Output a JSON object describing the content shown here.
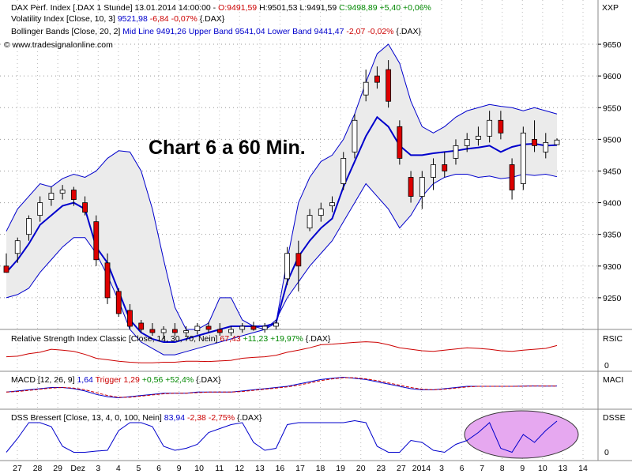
{
  "header": {
    "line1": {
      "prefix": "DAX Perf. Index [.DAX  1 Stunde] 13.01.2014 14:00:00 - ",
      "open": "O:9491,59",
      "high": "H:9501,53",
      "low": "L:9491,59",
      "close": "C:9498,89",
      "change": "+5,40 +0,06%"
    },
    "line2": {
      "prefix": "Volatility Index [Close, 10, 3] ",
      "value": "9521,98",
      "change": "-6,84 -0,07%",
      "suffix": " {.DAX}"
    },
    "line3": {
      "prefix": "Bollinger Bands [Close, 20, 2] ",
      "values": "Mid Line 9491,26 Upper Band 9541,04 Lower Band 9441,47",
      "change": "-2,07 -0,02%",
      "suffix": " {.DAX}"
    },
    "line4": "© www.tradesignalonline.com"
  },
  "overlay_title": "Chart 6 a 60 Min.",
  "panels": {
    "rsi": {
      "prefix": "Relative Strength Index Classic [Close, 14, 30, 70, Nein] ",
      "value": "67,43",
      "change": "+11,23 +19,97%",
      "suffix": " {.DAX}",
      "axis_label": "RSIC",
      "zero_label": "0"
    },
    "macd": {
      "prefix": "MACD [12, 26, 9] ",
      "value": "1,64",
      "trigger": "Trigger",
      "trigger_value": "1,29",
      "change": "+0,56 +52,4%",
      "suffix": " {.DAX}",
      "axis_label": "MACI"
    },
    "dss": {
      "prefix": "DSS Bressert [Close, 13, 4, 0, 100, Nein] ",
      "value": "83,94",
      "change": "-2,38 -2,75%",
      "suffix": " {.DAX}",
      "axis_label": "DSSE",
      "zero_label": "0"
    }
  },
  "colors": {
    "candle_red": "#dd0000",
    "band": "#0000cc",
    "band_fill": "#ebebeb",
    "rsi_line": "#cc0000",
    "highlight": "#e6a8f0"
  },
  "chart_data": {
    "type": "candlestick",
    "y_axis_label": "XXP",
    "ylim": [
      9200,
      9670
    ],
    "y_ticks": [
      9250,
      9300,
      9350,
      9400,
      9450,
      9500,
      9550,
      9600,
      9650
    ],
    "x_tick_labels": [
      "27",
      "28",
      "29",
      "Dez",
      "3",
      "4",
      "5",
      "6",
      "9",
      "10",
      "11",
      "12",
      "13",
      "16",
      "17",
      "18",
      "19",
      "20",
      "23",
      "27",
      "2014",
      "3",
      "6",
      "7",
      "8",
      "9",
      "10",
      "13",
      "14"
    ],
    "bollinger_upper": [
      9355,
      9390,
      9410,
      9430,
      9425,
      9438,
      9445,
      9440,
      9450,
      9470,
      9482,
      9480,
      9450,
      9390,
      9310,
      9235,
      9200,
      9200,
      9210,
      9250,
      9250,
      9215,
      9205,
      9200,
      9210,
      9310,
      9400,
      9440,
      9465,
      9475,
      9500,
      9540,
      9590,
      9635,
      9650,
      9620,
      9560,
      9520,
      9510,
      9520,
      9535,
      9545,
      9550,
      9555,
      9552,
      9550,
      9545,
      9550,
      9545,
      9540
    ],
    "bollinger_lower": [
      9250,
      9255,
      9265,
      9290,
      9310,
      9330,
      9345,
      9345,
      9320,
      9285,
      9245,
      9200,
      9180,
      9170,
      9160,
      9160,
      9165,
      9170,
      9175,
      9180,
      9185,
      9190,
      9195,
      9200,
      9215,
      9250,
      9275,
      9300,
      9320,
      9340,
      9370,
      9400,
      9430,
      9410,
      9390,
      9360,
      9380,
      9410,
      9430,
      9440,
      9445,
      9445,
      9440,
      9442,
      9438,
      9440,
      9445,
      9443,
      9445,
      9441
    ],
    "bollinger_mid": [
      9290,
      9310,
      9335,
      9365,
      9380,
      9395,
      9400,
      9390,
      9330,
      9305,
      9260,
      9215,
      9195,
      9185,
      9180,
      9180,
      9185,
      9190,
      9195,
      9200,
      9205,
      9205,
      9205,
      9205,
      9210,
      9275,
      9315,
      9340,
      9360,
      9375,
      9425,
      9465,
      9505,
      9535,
      9520,
      9490,
      9475,
      9475,
      9478,
      9480,
      9482,
      9485,
      9487,
      9490,
      9480,
      9488,
      9492,
      9493,
      9490,
      9491
    ],
    "candles": [
      {
        "o": 9300,
        "h": 9320,
        "l": 9290,
        "c": 9290
      },
      {
        "o": 9320,
        "h": 9345,
        "l": 9305,
        "c": 9340
      },
      {
        "o": 9350,
        "h": 9380,
        "l": 9340,
        "c": 9375
      },
      {
        "o": 9380,
        "h": 9410,
        "l": 9370,
        "c": 9400
      },
      {
        "o": 9405,
        "h": 9425,
        "l": 9395,
        "c": 9415
      },
      {
        "o": 9415,
        "h": 9428,
        "l": 9405,
        "c": 9420
      },
      {
        "o": 9420,
        "h": 9425,
        "l": 9395,
        "c": 9405
      },
      {
        "o": 9400,
        "h": 9410,
        "l": 9380,
        "c": 9385
      },
      {
        "o": 9370,
        "h": 9380,
        "l": 9300,
        "c": 9310
      },
      {
        "o": 9305,
        "h": 9320,
        "l": 9240,
        "c": 9250
      },
      {
        "o": 9260,
        "h": 9265,
        "l": 9220,
        "c": 9225
      },
      {
        "o": 9230,
        "h": 9240,
        "l": 9200,
        "c": 9205
      },
      {
        "o": 9210,
        "h": 9215,
        "l": 9195,
        "c": 9200
      },
      {
        "o": 9200,
        "h": 9210,
        "l": 9190,
        "c": 9195
      },
      {
        "o": 9195,
        "h": 9205,
        "l": 9185,
        "c": 9200
      },
      {
        "o": 9200,
        "h": 9210,
        "l": 9190,
        "c": 9195
      },
      {
        "o": 9195,
        "h": 9205,
        "l": 9188,
        "c": 9198
      },
      {
        "o": 9198,
        "h": 9210,
        "l": 9192,
        "c": 9205
      },
      {
        "o": 9205,
        "h": 9212,
        "l": 9195,
        "c": 9200
      },
      {
        "o": 9200,
        "h": 9210,
        "l": 9190,
        "c": 9195
      },
      {
        "o": 9195,
        "h": 9205,
        "l": 9190,
        "c": 9200
      },
      {
        "o": 9200,
        "h": 9210,
        "l": 9195,
        "c": 9205
      },
      {
        "o": 9205,
        "h": 9212,
        "l": 9198,
        "c": 9200
      },
      {
        "o": 9200,
        "h": 9210,
        "l": 9195,
        "c": 9205
      },
      {
        "o": 9205,
        "h": 9215,
        "l": 9200,
        "c": 9210
      },
      {
        "o": 9280,
        "h": 9330,
        "l": 9270,
        "c": 9320
      },
      {
        "o": 9320,
        "h": 9340,
        "l": 9260,
        "c": 9300
      },
      {
        "o": 9360,
        "h": 9390,
        "l": 9355,
        "c": 9380
      },
      {
        "o": 9380,
        "h": 9400,
        "l": 9370,
        "c": 9390
      },
      {
        "o": 9395,
        "h": 9410,
        "l": 9385,
        "c": 9400
      },
      {
        "o": 9430,
        "h": 9480,
        "l": 9420,
        "c": 9470
      },
      {
        "o": 9480,
        "h": 9540,
        "l": 9470,
        "c": 9530
      },
      {
        "o": 9570,
        "h": 9610,
        "l": 9560,
        "c": 9590
      },
      {
        "o": 9600,
        "h": 9615,
        "l": 9580,
        "c": 9590
      },
      {
        "o": 9610,
        "h": 9625,
        "l": 9550,
        "c": 9560
      },
      {
        "o": 9520,
        "h": 9530,
        "l": 9460,
        "c": 9470
      },
      {
        "o": 9440,
        "h": 9450,
        "l": 9400,
        "c": 9410
      },
      {
        "o": 9410,
        "h": 9450,
        "l": 9390,
        "c": 9440
      },
      {
        "o": 9440,
        "h": 9470,
        "l": 9420,
        "c": 9460
      },
      {
        "o": 9460,
        "h": 9480,
        "l": 9440,
        "c": 9450
      },
      {
        "o": 9470,
        "h": 9500,
        "l": 9460,
        "c": 9490
      },
      {
        "o": 9490,
        "h": 9510,
        "l": 9480,
        "c": 9500
      },
      {
        "o": 9500,
        "h": 9520,
        "l": 9490,
        "c": 9505
      },
      {
        "o": 9505,
        "h": 9545,
        "l": 9495,
        "c": 9530
      },
      {
        "o": 9530,
        "h": 9545,
        "l": 9500,
        "c": 9510
      },
      {
        "o": 9460,
        "h": 9470,
        "l": 9405,
        "c": 9420
      },
      {
        "o": 9430,
        "h": 9520,
        "l": 9420,
        "c": 9510
      },
      {
        "o": 9500,
        "h": 9530,
        "l": 9480,
        "c": 9490
      },
      {
        "o": 9480,
        "h": 9510,
        "l": 9470,
        "c": 9495
      },
      {
        "o": 9491.59,
        "h": 9501.53,
        "l": 9491.59,
        "c": 9498.89
      }
    ],
    "rsi": [
      30,
      32,
      40,
      45,
      55,
      52,
      48,
      38,
      25,
      20,
      15,
      12,
      10,
      10,
      12,
      12,
      15,
      15,
      14,
      16,
      18,
      25,
      28,
      30,
      35,
      45,
      52,
      60,
      70,
      72,
      75,
      78,
      80,
      78,
      70,
      60,
      55,
      50,
      48,
      52,
      56,
      60,
      58,
      55,
      50,
      48,
      52,
      55,
      58,
      67.43
    ],
    "macd": [
      -1,
      -0.5,
      0,
      0.5,
      1,
      1,
      0.5,
      -0.5,
      -2,
      -3,
      -3.5,
      -3,
      -2.5,
      -2,
      -1.5,
      -1.5,
      -1.5,
      -1,
      -1,
      -1,
      -1,
      -0.5,
      0,
      0.5,
      1,
      1.5,
      2.5,
      3.5,
      4.5,
      5,
      5.5,
      5,
      4.5,
      3.5,
      2.5,
      1.5,
      0.5,
      0,
      0,
      0.5,
      1,
      1.5,
      1.5,
      1.5,
      1.5,
      1.5,
      1.6,
      1.7,
      1.6,
      1.64
    ],
    "dss": [
      5,
      40,
      80,
      80,
      70,
      20,
      5,
      5,
      8,
      10,
      60,
      80,
      80,
      70,
      20,
      10,
      15,
      25,
      55,
      65,
      75,
      80,
      30,
      10,
      15,
      75,
      80,
      80,
      80,
      80,
      80,
      85,
      80,
      20,
      5,
      5,
      35,
      30,
      10,
      5,
      25,
      35,
      55,
      80,
      15,
      5,
      50,
      30,
      60,
      83.94
    ]
  }
}
